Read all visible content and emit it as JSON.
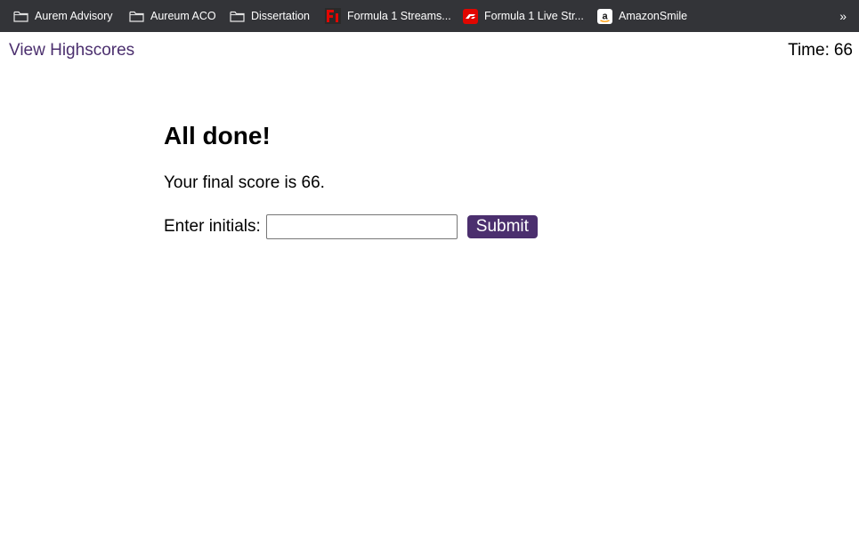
{
  "bookmarks": [
    {
      "label": "Aurem Advisory",
      "icon": "folder-icon"
    },
    {
      "label": "Aureum ACO",
      "icon": "folder-icon"
    },
    {
      "label": "Dissertation",
      "icon": "folder-icon"
    },
    {
      "label": "Formula 1 Streams...",
      "icon": "f1-streams-icon"
    },
    {
      "label": "Formula 1 Live Str...",
      "icon": "f1-live-icon"
    },
    {
      "label": "AmazonSmile",
      "icon": "amazon-icon"
    }
  ],
  "bookmarks_overflow": "»",
  "header": {
    "highscores_link": "View Highscores",
    "time_label": "Time:",
    "time_value": "66"
  },
  "result": {
    "title": "All done!",
    "score_text": "Your final score is 66.",
    "initials_label": "Enter initials:",
    "initials_value": "",
    "submit_label": "Submit"
  },
  "colors": {
    "bookmarks_bg": "#333438",
    "accent": "#4b2f6e"
  }
}
